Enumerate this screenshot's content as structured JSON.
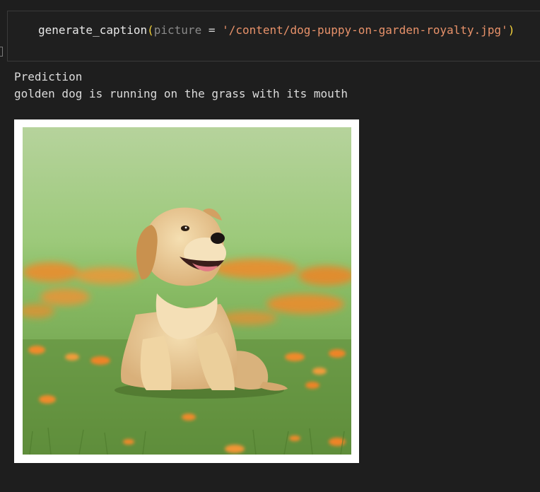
{
  "cell": {
    "code": {
      "function_name": "generate_caption",
      "open_paren": "(",
      "param_name": "picture",
      "operator": " = ",
      "string_value": "'/content/dog-puppy-on-garden-royalty.jpg'",
      "close_paren": ")"
    }
  },
  "output": {
    "label": "Prediction",
    "caption": "golden dog is running on the grass with its mouth"
  },
  "image": {
    "subject": "golden-retriever-puppy",
    "colors": {
      "frame": "#ffffff",
      "sky_top": "#b4d29a",
      "grass": "#6a9a46",
      "flowers": "#f08a2a",
      "fur": "#e8c78e"
    }
  }
}
